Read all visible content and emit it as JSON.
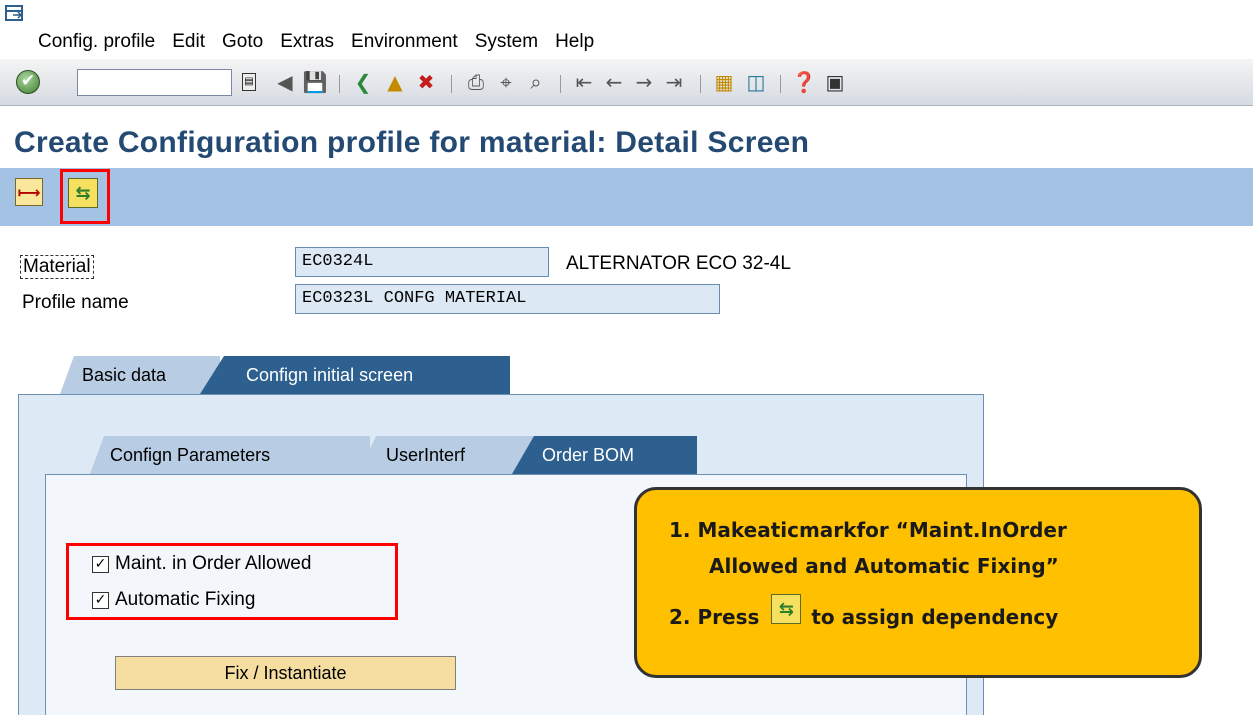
{
  "menu": [
    "Config. profile",
    "Edit",
    "Goto",
    "Extras",
    "Environment",
    "System",
    "Help"
  ],
  "toolbar": {
    "command_value": "",
    "icons": [
      "enter-icon",
      "back-icon",
      "save-icon",
      "back-nav-icon",
      "exit-icon",
      "cancel-icon",
      "print-icon",
      "find-icon",
      "find-next-icon",
      "first-page-icon",
      "prev-page-icon",
      "next-page-icon",
      "last-page-icon",
      "new-session-icon",
      "shortcut-icon",
      "help-icon",
      "customize-icon"
    ]
  },
  "title": "Create Configuration profile for material: Detail Screen",
  "app_toolbar": {
    "buttons": [
      "dependency-overview-icon",
      "assign-dependency-icon"
    ]
  },
  "fields": {
    "material_label": "Material",
    "material_value": "EC0324L",
    "material_desc": "ALTERNATOR ECO 32-4L",
    "profile_label": "Profile name",
    "profile_value": "EC0323L CONFG MATERIAL"
  },
  "tabs": {
    "outer": [
      "Basic data",
      "Confign initial screen"
    ],
    "inner": [
      "Confign Parameters",
      "UserInterf",
      "Order BOM"
    ]
  },
  "checkboxes": [
    {
      "label": "Maint. in Order Allowed",
      "checked": true
    },
    {
      "label": "Automatic Fixing",
      "checked": true
    }
  ],
  "fix_button": "Fix / Instantiate",
  "callout": {
    "line1": "1. Makeaticmarkfor “Maint.InOrder",
    "line2": "Allowed and Automatic Fixing”",
    "line3_pre": "2. Press",
    "line3_post": "to assign dependency"
  },
  "colors": {
    "title": "#244a73",
    "app_toolbar": "#a4c3e4",
    "tab_active": "#2d5f8f",
    "callout": "#ffc000",
    "highlight": "#ff0000"
  }
}
